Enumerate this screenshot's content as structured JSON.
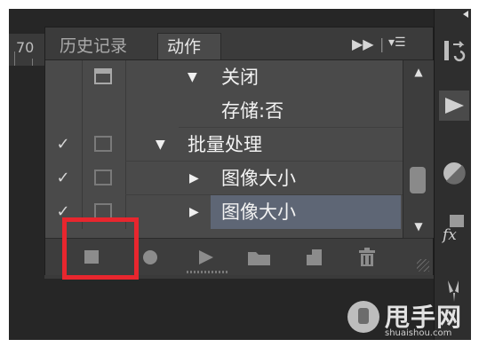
{
  "ruler": {
    "label": "70"
  },
  "tabs": {
    "history": "历史记录",
    "actions": "动作",
    "forward_icon": "double-chevron-right",
    "menu_icon": "panel-menu"
  },
  "actions_list": [
    {
      "check": "",
      "dialog": "on",
      "indent": 1,
      "expanded": true,
      "label": "关闭"
    },
    {
      "check": "",
      "dialog": "none",
      "indent": 2,
      "expanded": null,
      "label": "存储:否"
    },
    {
      "check": "✓",
      "dialog": "off",
      "indent": 0,
      "expanded": true,
      "label": "批量处理"
    },
    {
      "check": "✓",
      "dialog": "off",
      "indent": 1,
      "expanded": false,
      "label": "图像大小"
    },
    {
      "check": "✓",
      "dialog": "off",
      "indent": 1,
      "expanded": false,
      "label": "图像大小",
      "selected": true
    }
  ],
  "toolbar": {
    "buttons": [
      "stop-icon",
      "record-icon",
      "play-icon",
      "folder-icon",
      "new-action-icon",
      "trash-icon"
    ]
  },
  "right_dock": {
    "buttons": [
      "history-icon",
      "play-icon",
      "adjustment-icon",
      "fx-icon",
      "brush-icon"
    ]
  },
  "watermark": {
    "brand": "甩手网",
    "domain": "shuaishou.com"
  },
  "colors": {
    "highlight": "#e8262e",
    "selected_row": "#5e6675",
    "panel": "#4a4a4a"
  }
}
